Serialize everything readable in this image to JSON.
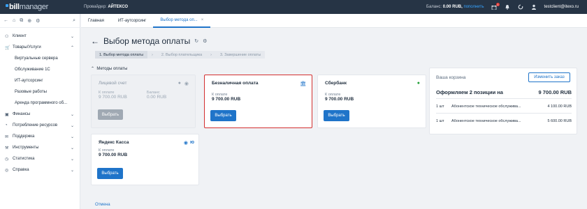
{
  "header": {
    "logo_bill": "bill",
    "logo_manager": "manager",
    "provider_label": "Провайдер:",
    "provider_name": "АЙТЕКСО",
    "balance_label": "Баланс:",
    "balance_value": "0.00 RUB,",
    "topup_link": "пополнить",
    "notifications_count": "1",
    "user": "testclient@itexo.ru"
  },
  "sidebar": {
    "items": [
      {
        "label": "Клиент"
      },
      {
        "label": "Товары/Услуги"
      },
      {
        "label": "Финансы"
      },
      {
        "label": "Потребление ресурсов"
      },
      {
        "label": "Поддержка"
      },
      {
        "label": "Инструменты"
      },
      {
        "label": "Статистика"
      },
      {
        "label": "Справка"
      }
    ],
    "subitems": [
      "Виртуальные сервера",
      "Обслуживание 1С",
      "ИТ-аутсорсинг",
      "Разовые работы",
      "Аренда программного об..."
    ]
  },
  "tabs": [
    "Главная",
    "ИТ-аутсорсинг",
    "Выбор метода оп..."
  ],
  "page": {
    "title": "Выбор метода оплаты",
    "steps": [
      "1. Выбор метода оплаты",
      "2. Выбор плательщика",
      "3. Завершение оплаты"
    ],
    "section": "Методы оплаты",
    "cancel": "Отмена"
  },
  "cards": [
    {
      "name": "Лицевой счет",
      "lbl1": "К оплате",
      "val1": "9 700.00 RUB",
      "lbl2": "Баланс",
      "val2": "0.00 RUB",
      "button": "Выбрать"
    },
    {
      "name": "Безналичная оплата",
      "lbl1": "К оплате",
      "val1": "9 700.00 RUB",
      "button": "Выбрать"
    },
    {
      "name": "Сбербанк",
      "lbl1": "К оплате",
      "val1": "9 700.00 RUB",
      "button": "Выбрать"
    },
    {
      "name": "Яндекс Касса",
      "lbl1": "К оплате",
      "val1": "9 700.00 RUB",
      "button": "Выбрать"
    }
  ],
  "cart": {
    "header": "Ваша корзина",
    "edit_button": "Изменить заказ",
    "summary_label": "Оформляем 2 позиции на",
    "summary_total": "9 700.00 RUB",
    "rows": [
      {
        "qty": "1 шт",
        "name": "Абонентское техническое обслужива...",
        "price": "4 100.00 RUB"
      },
      {
        "qty": "1 шт",
        "name": "Абонентское техническое обслужива...",
        "price": "5 600.00 RUB"
      }
    ]
  },
  "colors": {
    "accent": "#1f74c9",
    "topbar": "#263445",
    "highlight": "#d32f2f",
    "sber": "#21a038"
  }
}
